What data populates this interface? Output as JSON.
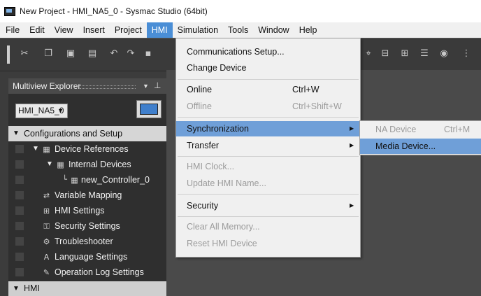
{
  "window": {
    "title": "New Project - HMI_NA5_0 - Sysmac Studio (64bit)"
  },
  "menubar": {
    "items": [
      "File",
      "Edit",
      "View",
      "Insert",
      "Project",
      "HMI",
      "Simulation",
      "Tools",
      "Window",
      "Help"
    ],
    "active": "HMI"
  },
  "toolbar": {
    "icons": [
      "cut-icon",
      "copy-icon",
      "paste-icon",
      "delete-icon",
      "undo-icon",
      "redo-icon",
      "build-icon",
      "find-icon",
      "compare-icon",
      "transfer-icon",
      "list-icon",
      "watch-icon",
      "more-icon"
    ]
  },
  "explorer": {
    "title": "Multiview Explorer",
    "device": "HMI_NA5_0",
    "tree": [
      {
        "label": "Configurations and Setup",
        "kind": "category"
      },
      {
        "label": "Device References"
      },
      {
        "label": "Internal Devices"
      },
      {
        "label": "new_Controller_0"
      },
      {
        "label": "Variable Mapping"
      },
      {
        "label": "HMI Settings"
      },
      {
        "label": "Security Settings"
      },
      {
        "label": "Troubleshooter"
      },
      {
        "label": "Language Settings"
      },
      {
        "label": "Operation Log Settings"
      },
      {
        "label": "HMI",
        "kind": "category"
      }
    ]
  },
  "hmi_menu": {
    "items": [
      {
        "label": "Communications Setup...",
        "shortcut": ""
      },
      {
        "label": "Change Device",
        "shortcut": ""
      },
      {
        "label": "Online",
        "shortcut": "Ctrl+W"
      },
      {
        "label": "Offline",
        "shortcut": "Ctrl+Shift+W"
      },
      {
        "label": "Synchronization",
        "shortcut": ""
      },
      {
        "label": "Transfer",
        "shortcut": ""
      },
      {
        "label": "HMI Clock...",
        "shortcut": ""
      },
      {
        "label": "Update HMI Name...",
        "shortcut": ""
      },
      {
        "label": "Security",
        "shortcut": ""
      },
      {
        "label": "Clear All Memory...",
        "shortcut": ""
      },
      {
        "label": "Reset HMI Device",
        "shortcut": ""
      }
    ],
    "submenu_arrow": "▶"
  },
  "sync_submenu": {
    "items": [
      {
        "label": "NA Device",
        "shortcut": "Ctrl+M"
      },
      {
        "label": "Media Device...",
        "shortcut": ""
      }
    ]
  },
  "colors": {
    "highlight": "#6f9fd8",
    "menu_active": "#4a8ed6",
    "panel_bg": "#2f2f2f",
    "workspace_bg": "#4a4a4a"
  }
}
